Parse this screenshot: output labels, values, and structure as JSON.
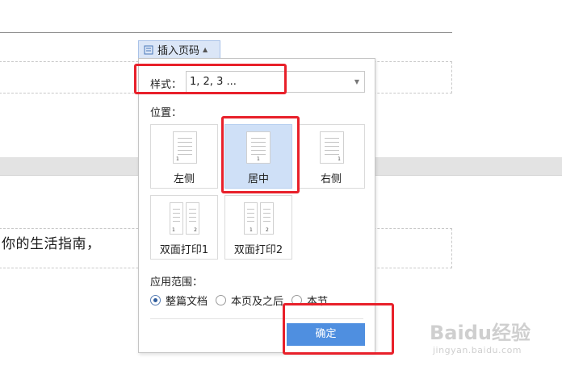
{
  "document": {
    "body_text": "你的生活指南，"
  },
  "tab": {
    "label": "插入页码",
    "icon": "page-number-icon"
  },
  "panel": {
    "style_label": "样式：",
    "style_value": "1, 2, 3 ...",
    "position_label": "位置：",
    "positions": [
      {
        "label": "左侧",
        "selected": false
      },
      {
        "label": "居中",
        "selected": true
      },
      {
        "label": "右侧",
        "selected": false
      },
      {
        "label": "双面打印1",
        "selected": false
      },
      {
        "label": "双面打印2",
        "selected": false
      }
    ],
    "scope_label": "应用范围：",
    "scope_options": [
      {
        "label": "整篇文档",
        "selected": true
      },
      {
        "label": "本页及之后",
        "selected": false
      },
      {
        "label": "本节",
        "selected": false
      }
    ],
    "ok_label": "确定"
  },
  "watermark": {
    "brand": "Baidu经验",
    "url": "jingyan.baidu.com"
  },
  "colors": {
    "highlight": "#e8202a",
    "selected_card": "#cfe0f7",
    "ok_button": "#4f8fe0",
    "tab_bg": "#dbe6f7"
  }
}
